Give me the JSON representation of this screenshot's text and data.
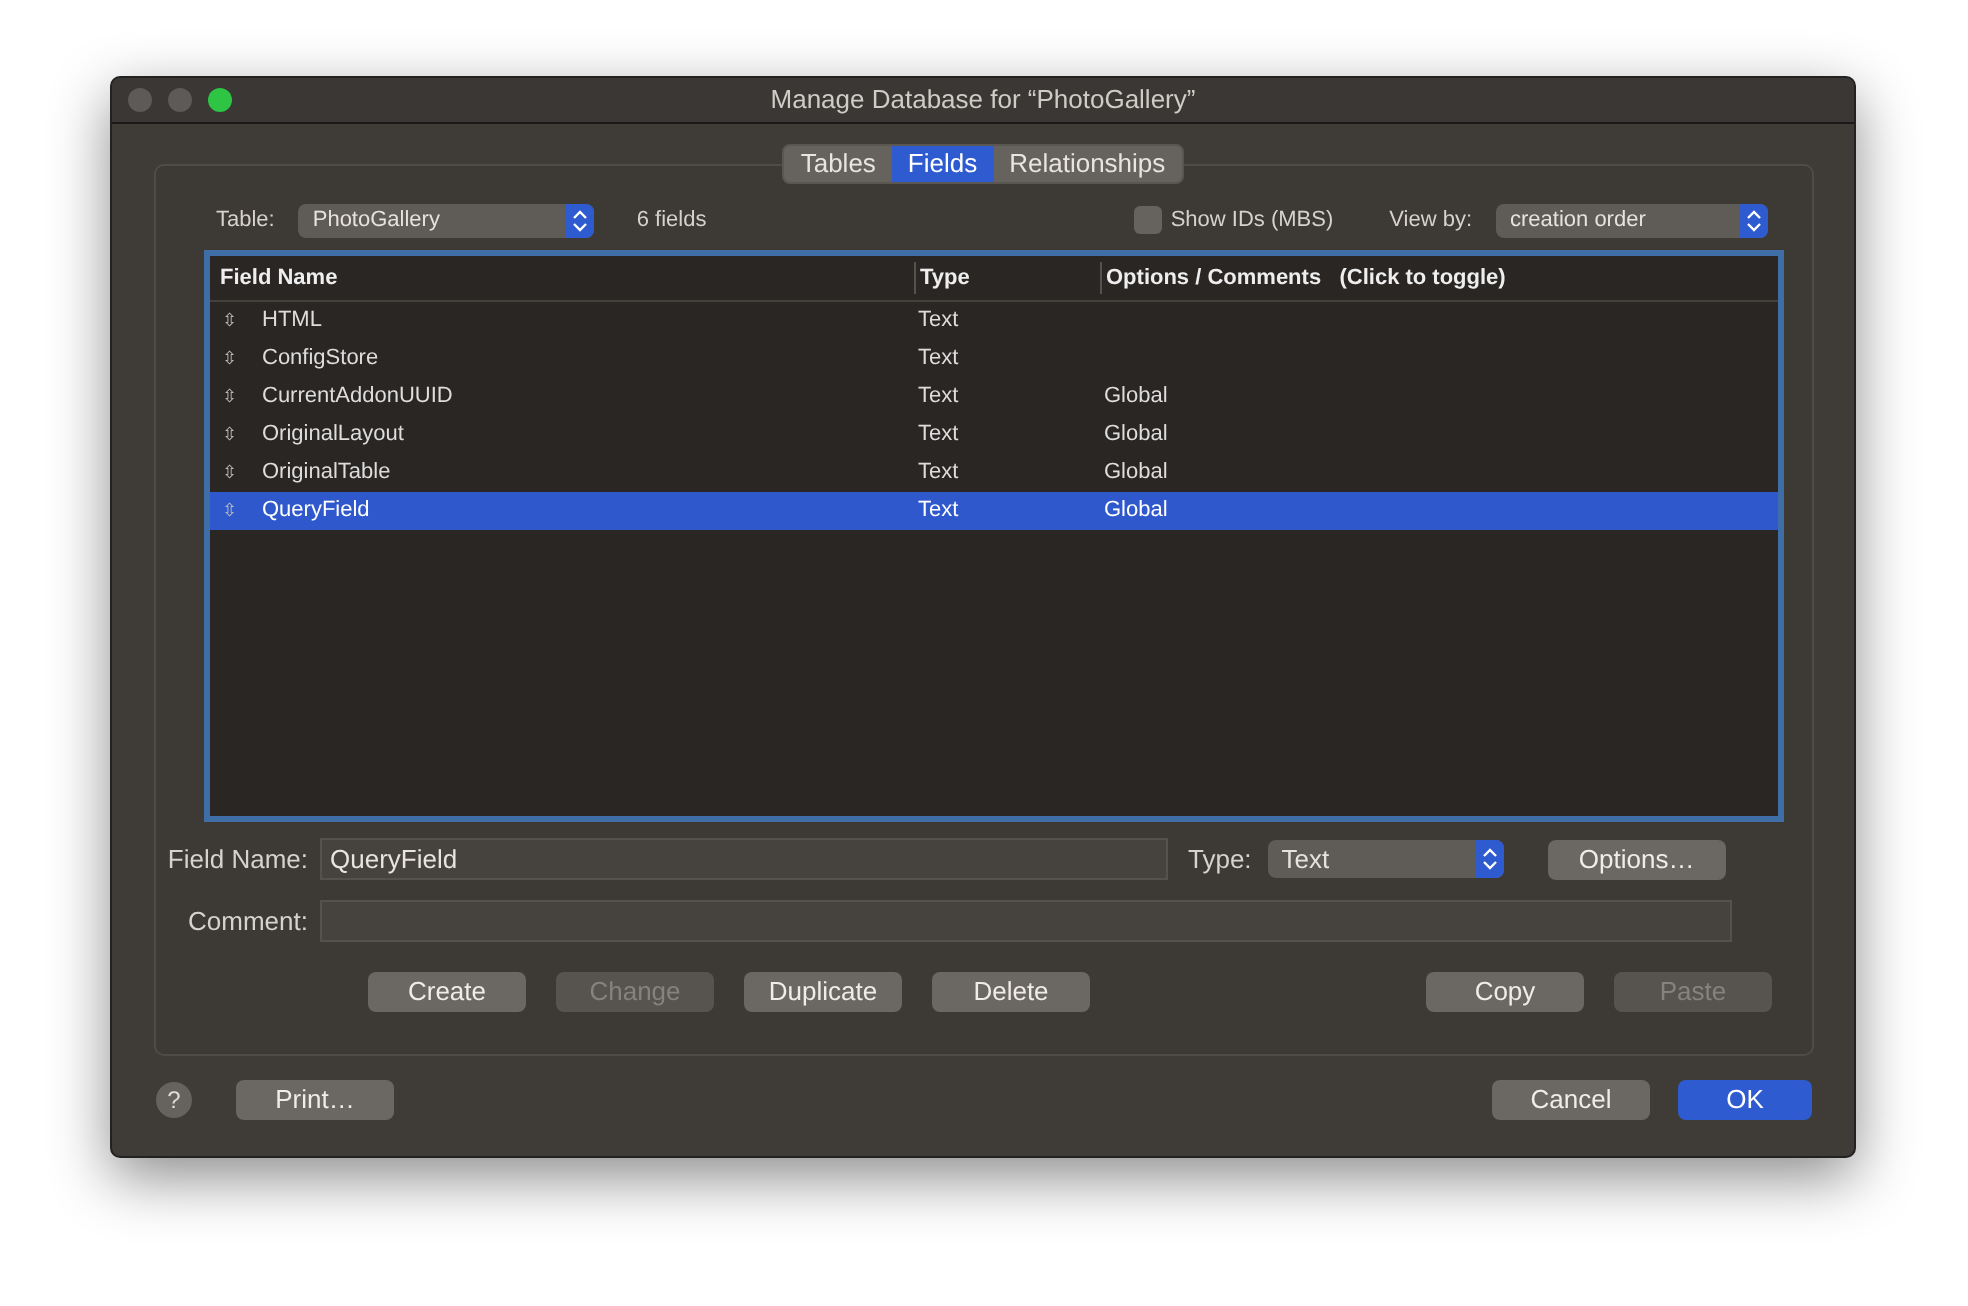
{
  "window": {
    "title": "Manage Database for “PhotoGallery”",
    "traffic_lights": [
      {
        "active": false
      },
      {
        "active": false
      },
      {
        "active": true
      }
    ]
  },
  "tabs": [
    {
      "label": "Tables",
      "selected": false
    },
    {
      "label": "Fields",
      "selected": true
    },
    {
      "label": "Relationships",
      "selected": false
    }
  ],
  "table_select": {
    "label": "Table:",
    "value": "PhotoGallery"
  },
  "field_count": "6 fields",
  "show_ids": {
    "label": "Show IDs (MBS)",
    "checked": false
  },
  "view_by": {
    "label": "View by:",
    "value": "creation order"
  },
  "columns": [
    "Field Name",
    "Type",
    "Options / Comments   (Click to toggle)"
  ],
  "rows": [
    {
      "handle": "⇳",
      "name": "HTML",
      "type": "Text",
      "options": "",
      "selected": false
    },
    {
      "handle": "⇳",
      "name": "ConfigStore",
      "type": "Text",
      "options": "",
      "selected": false
    },
    {
      "handle": "⇳",
      "name": "CurrentAddonUUID",
      "type": "Text",
      "options": "Global",
      "selected": false
    },
    {
      "handle": "⇳",
      "name": "OriginalLayout",
      "type": "Text",
      "options": "Global",
      "selected": false
    },
    {
      "handle": "⇳",
      "name": "OriginalTable",
      "type": "Text",
      "options": "Global",
      "selected": false
    },
    {
      "handle": "⇳",
      "name": "QueryField",
      "type": "Text",
      "options": "Global",
      "selected": true
    }
  ],
  "field_name": {
    "label": "Field Name:",
    "value": "QueryField"
  },
  "type_select": {
    "label": "Type:",
    "value": "Text"
  },
  "options_button": {
    "label": "Options…",
    "disabled": false
  },
  "comment": {
    "label": "Comment:"
  },
  "edit_buttons": [
    {
      "label": "Create",
      "disabled": false
    },
    {
      "label": "Change",
      "disabled": true
    },
    {
      "label": "Duplicate",
      "disabled": false
    },
    {
      "label": "Delete",
      "disabled": false
    }
  ],
  "clip_buttons": [
    {
      "label": "Copy",
      "disabled": false
    },
    {
      "label": "Paste",
      "disabled": true
    }
  ],
  "help": "?",
  "print_button": {
    "label": "Print…",
    "disabled": false
  },
  "dialog_buttons": [
    {
      "label": "Cancel",
      "default": false
    },
    {
      "label": "OK",
      "default": true
    }
  ]
}
